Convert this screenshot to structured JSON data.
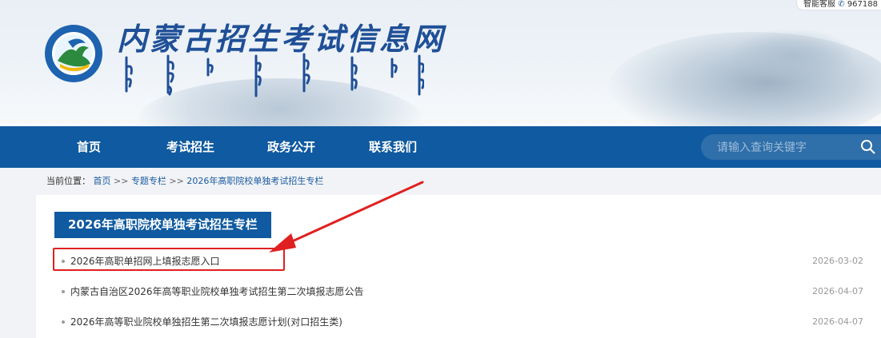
{
  "header": {
    "site_title": "内蒙古招生考试信息网",
    "customer_service": {
      "label": "智能客服",
      "number_partial": "967188"
    }
  },
  "nav": {
    "items": [
      {
        "label": "首页"
      },
      {
        "label": "考试招生"
      },
      {
        "label": "政务公开"
      },
      {
        "label": "联系我们"
      }
    ],
    "search": {
      "placeholder": "请输入查询关键字"
    }
  },
  "breadcrumb": {
    "prefix": "当前位置：",
    "links": [
      "首页",
      "专题专栏",
      "2026年高职院校单独考试招生专栏"
    ],
    "separator": ">>"
  },
  "section": {
    "title": "2026年高职院校单独考试招生专栏",
    "items": [
      {
        "title": "2026年高职单招网上填报志愿入口",
        "date": "2026-03-02"
      },
      {
        "title": "内蒙古自治区2026年高等职业院校单独考试招生第二次填报志愿公告",
        "date": "2026-04-07"
      },
      {
        "title": "2026年高等职业院校单独招生第二次填报志愿计划(对口招生类)",
        "date": "2026-04-07"
      }
    ]
  },
  "colors": {
    "nav_bg": "#0f5aa0",
    "title_blue": "#1f4f97",
    "highlight_red": "#e02020",
    "link_blue": "#1b5aa0"
  }
}
